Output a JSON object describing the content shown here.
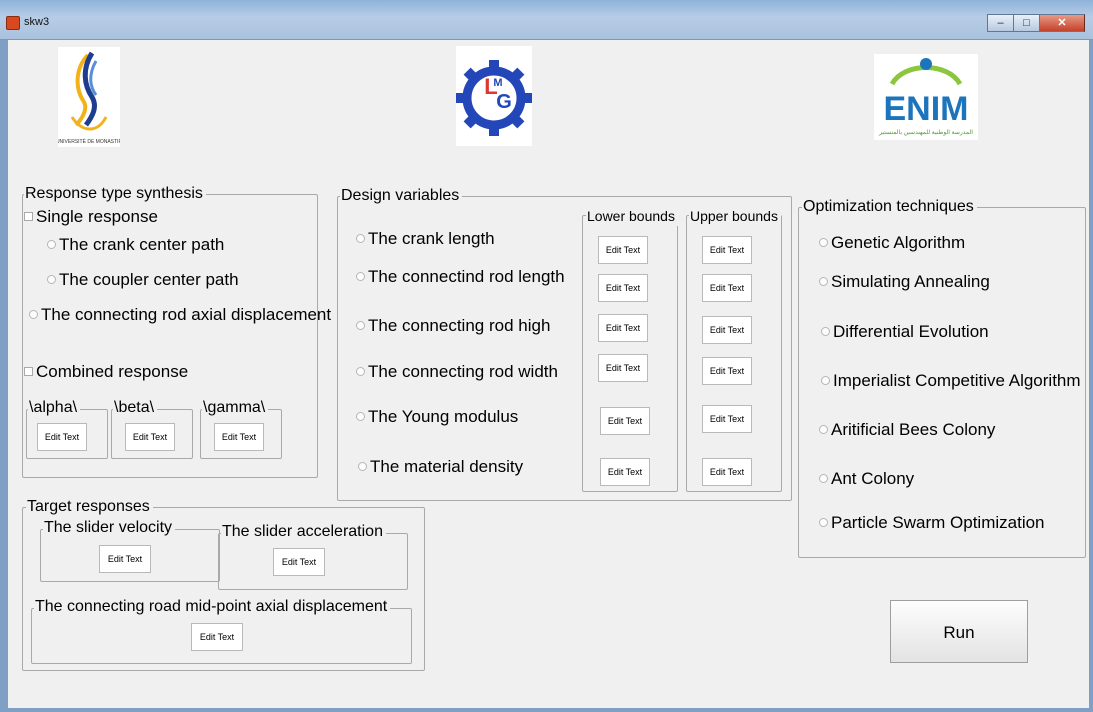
{
  "window": {
    "title": "skw3",
    "minimize": "–",
    "maximize": "□",
    "close": "✕"
  },
  "logos": {
    "left": "university-logo",
    "center": "lmg-gear-logo",
    "right": {
      "text": "ENIM",
      "subtitle": "المدرسة الوطنية للمهندسين بالمنستير"
    }
  },
  "response_panel": {
    "title": "Response type synthesis",
    "single": "Single response",
    "crank_path": "The crank center path",
    "coupler_path": "The coupler center path",
    "rod_axial": "The connecting rod axial displacement",
    "combined": "Combined response",
    "alpha": "\\alpha\\",
    "beta": "\\beta\\",
    "gamma": "\\gamma\\"
  },
  "design_panel": {
    "title": "Design variables",
    "lower_label": "Lower bounds",
    "upper_label": "Upper bounds",
    "vars": [
      "The crank length",
      "The connectind rod length",
      "The connecting rod high",
      "The connecting rod width",
      "The Young modulus",
      "The material density"
    ]
  },
  "target_panel": {
    "title": "Target responses",
    "slider_velocity": "The slider velocity",
    "slider_accel": "The slider acceleration",
    "midpoint": "The connecting road mid-point axial displacement"
  },
  "opt_panel": {
    "title": "Optimization techniques",
    "items": [
      "Genetic Algorithm",
      "Simulating Annealing",
      "Differential Evolution",
      "Imperialist Competitive Algorithm",
      "Aritificial Bees Colony",
      "Ant Colony",
      "Particle Swarm Optimization"
    ]
  },
  "edit_text": "Edit Text",
  "run_label": "Run"
}
